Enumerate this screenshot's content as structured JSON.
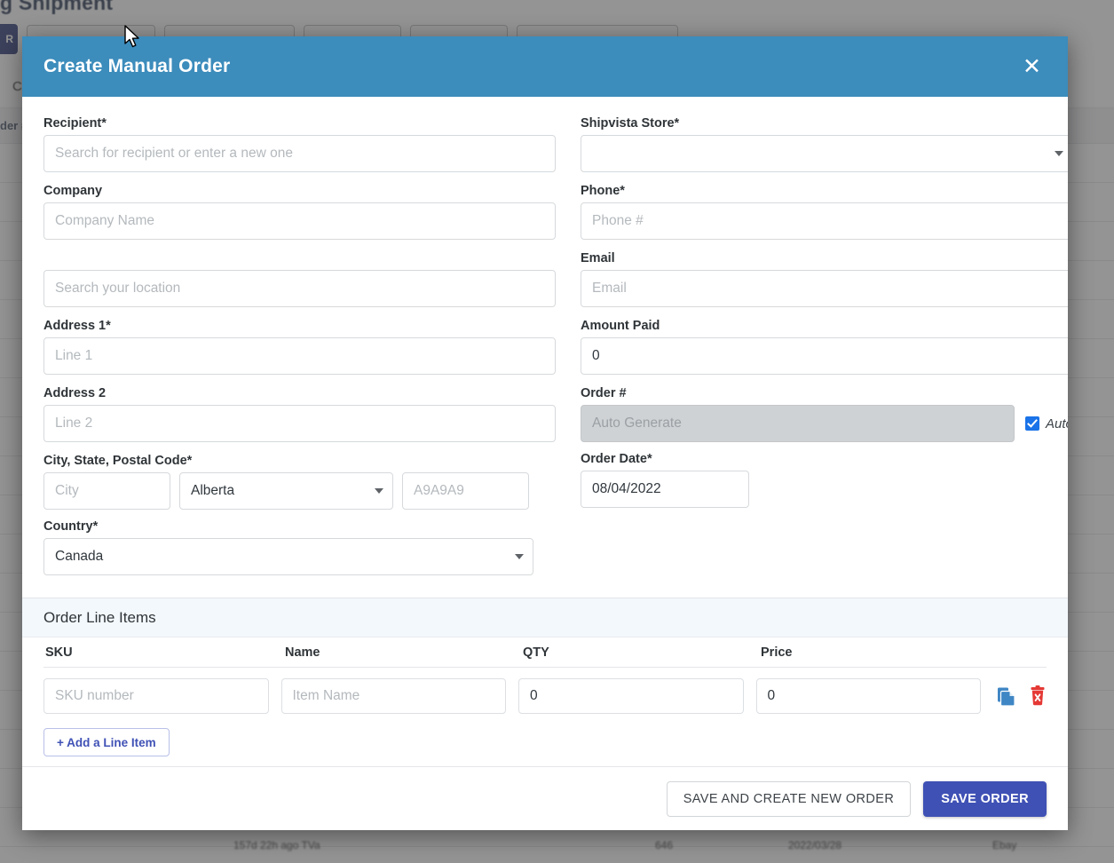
{
  "background": {
    "page_title": "g Shipment",
    "dark_button_label": "R",
    "panel_header_text": "C",
    "table_header_text": "der #",
    "bottom_row": {
      "col1": "157d 22h ago    TVa",
      "col2": "646",
      "col3": "2022/03/28",
      "col4": "Ebay"
    }
  },
  "modal": {
    "title": "Create Manual Order",
    "close_icon": "close-icon",
    "left_column": {
      "recipient": {
        "label": "Recipient*",
        "placeholder": "Search for recipient or enter a new one",
        "value": ""
      },
      "company": {
        "label": "Company",
        "placeholder": "Company Name",
        "value": ""
      },
      "location_search": {
        "label": "",
        "placeholder": "Search your location",
        "value": ""
      },
      "address1": {
        "label": "Address 1*",
        "placeholder": "Line 1",
        "value": ""
      },
      "address2": {
        "label": "Address 2",
        "placeholder": "Line 2",
        "value": ""
      },
      "city_state_postal": {
        "label": "City, State, Postal Code*",
        "city": {
          "placeholder": "City",
          "value": ""
        },
        "state": {
          "value": "Alberta"
        },
        "postal": {
          "placeholder": "A9A9A9",
          "value": ""
        }
      },
      "country": {
        "label": "Country*",
        "value": "Canada"
      }
    },
    "right_column": {
      "shipvista_store": {
        "label": "Shipvista Store*",
        "value": ""
      },
      "phone": {
        "label": "Phone*",
        "placeholder": "Phone #",
        "value": ""
      },
      "email": {
        "label": "Email",
        "placeholder": "Email",
        "value": ""
      },
      "amount_paid": {
        "label": "Amount Paid",
        "value": "0"
      },
      "order_number": {
        "label": "Order #",
        "placeholder": "Auto Generate",
        "value": "",
        "auto_label": "Auto",
        "auto_checked": true
      },
      "order_date": {
        "label": "Order Date*",
        "value": "08/04/2022"
      }
    },
    "line_items": {
      "section_title": "Order Line Items",
      "columns": [
        "SKU",
        "Name",
        "QTY",
        "Price"
      ],
      "rows": [
        {
          "sku": "",
          "sku_placeholder": "SKU number",
          "name": "",
          "name_placeholder": "Item Name",
          "qty": "0",
          "price": "0",
          "copy_icon": "copy-icon",
          "delete_icon": "delete-icon"
        }
      ],
      "add_button": "+ Add a Line Item"
    },
    "footer": {
      "save_and_new_label": "SAVE AND CREATE NEW ORDER",
      "save_label": "SAVE ORDER"
    }
  },
  "colors": {
    "header_blue": "#3c8cbc",
    "primary_blue": "#3f51b5",
    "section_bg": "#f3f8fd",
    "checkbox_blue": "#1a73e8",
    "delete_red": "#e53935",
    "copy_blue": "#3f86c4"
  }
}
